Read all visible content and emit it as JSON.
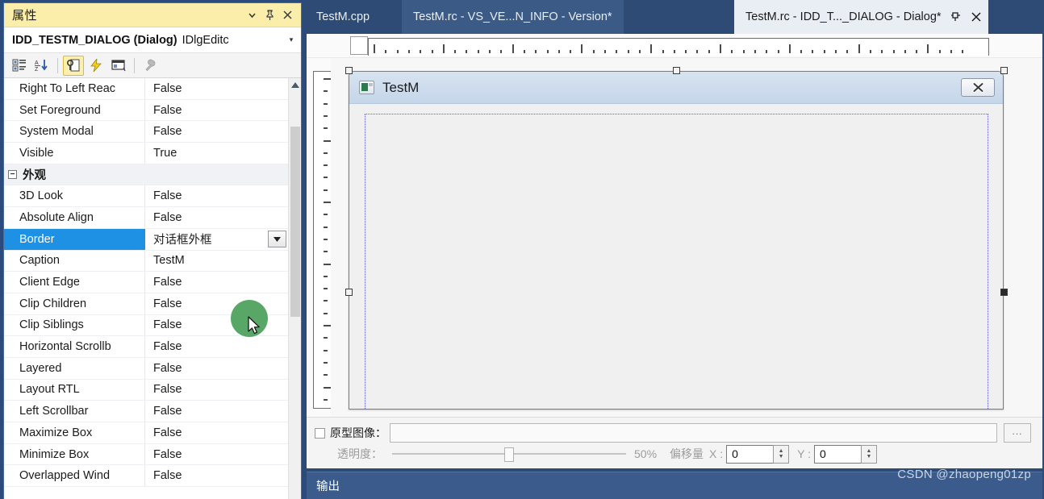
{
  "properties_pane": {
    "title": "属性",
    "title_buttons": [
      {
        "name": "chevron-down-icon",
        "label": "▾"
      },
      {
        "name": "pin-icon",
        "label": "pin"
      },
      {
        "name": "close-icon",
        "label": "✕"
      }
    ],
    "object_name": "IDD_TESTM_DIALOG (Dialog)",
    "object_type": "IDlgEditc",
    "object_chevron": "▾",
    "toolbar": [
      {
        "name": "categorized-view-button",
        "tip": "Categorized",
        "active": false
      },
      {
        "name": "alphabetical-sort-button",
        "tip": "Alphabetical",
        "active": false
      },
      {
        "name": "properties-button",
        "tip": "Properties",
        "active": true
      },
      {
        "name": "events-button",
        "tip": "Events",
        "active": false
      },
      {
        "name": "messages-button",
        "tip": "Messages",
        "active": false
      },
      {
        "name": "property-pages-button",
        "tip": "Property Pages",
        "active": false,
        "disabled": true
      }
    ],
    "rows": [
      {
        "name": "Right To Left Reac",
        "value": "False",
        "type": "prop"
      },
      {
        "name": "Set Foreground",
        "value": "False",
        "type": "prop"
      },
      {
        "name": "System Modal",
        "value": "False",
        "type": "prop"
      },
      {
        "name": "Visible",
        "value": "True",
        "type": "prop"
      },
      {
        "name": "外观",
        "value": "",
        "type": "category",
        "expander": "−"
      },
      {
        "name": "3D Look",
        "value": "False",
        "type": "prop"
      },
      {
        "name": "Absolute Align",
        "value": "False",
        "type": "prop"
      },
      {
        "name": "Border",
        "value": "对话框外框",
        "type": "prop",
        "selected": true,
        "dropdown": true
      },
      {
        "name": "Caption",
        "value": "TestM",
        "type": "prop"
      },
      {
        "name": "Client Edge",
        "value": "False",
        "type": "prop"
      },
      {
        "name": "Clip Children",
        "value": "False",
        "type": "prop"
      },
      {
        "name": "Clip Siblings",
        "value": "False",
        "type": "prop"
      },
      {
        "name": "Horizontal Scrollb",
        "value": "False",
        "type": "prop"
      },
      {
        "name": "Layered",
        "value": "False",
        "type": "prop"
      },
      {
        "name": "Layout RTL",
        "value": "False",
        "type": "prop"
      },
      {
        "name": "Left Scrollbar",
        "value": "False",
        "type": "prop"
      },
      {
        "name": "Maximize Box",
        "value": "False",
        "type": "prop"
      },
      {
        "name": "Minimize Box",
        "value": "False",
        "type": "prop"
      },
      {
        "name": "Overlapped Wind",
        "value": "False",
        "type": "prop"
      }
    ]
  },
  "editor": {
    "tabs": [
      {
        "label": "TestM.cpp",
        "active": false
      },
      {
        "label": "TestM.rc - VS_VE...N_INFO - Version*",
        "active": false
      },
      {
        "label": "TestM.rc - IDD_T..._DIALOG - Dialog*",
        "active": true
      }
    ],
    "tab_buttons": [
      {
        "name": "tab-pin-icon",
        "label": "pin"
      },
      {
        "name": "tab-close-icon",
        "label": "✕"
      }
    ],
    "dialog": {
      "title": "TestM",
      "close_label": "✕",
      "icon_name": "dialog-app-icon"
    }
  },
  "prototype_bar": {
    "checkbox_label": "原型图像：",
    "path_value": "",
    "browse_label": "...",
    "transparency_label": "透明度：",
    "transparency_value": "50%",
    "transparency_percent": 50,
    "offset_label": "偏移量",
    "x_label": "X :",
    "x_value": "0",
    "y_label": "Y :",
    "y_value": "0"
  },
  "output_panel": {
    "label": "输出"
  },
  "watermark": "CSDN @zhaopeng01zp",
  "colors": {
    "vs_chrome": "#2d4b75",
    "panel_title": "#fbeeab",
    "selection": "#1f91e5",
    "active_tab": "#e9eef5"
  }
}
